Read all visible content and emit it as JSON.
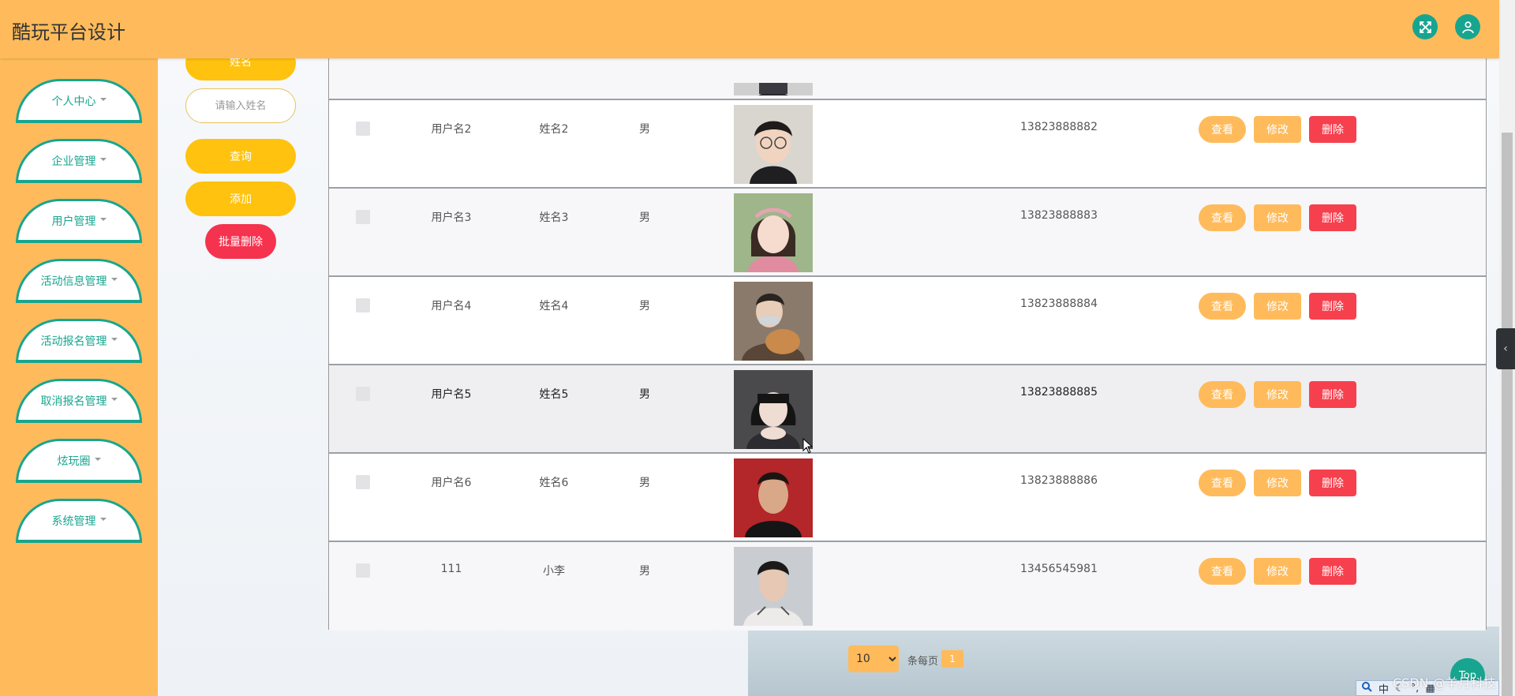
{
  "header": {
    "title": "酷玩平台设计",
    "fullscreen_icon": "fullscreen-icon",
    "user_icon": "user-icon"
  },
  "sidebar": {
    "items": [
      {
        "label": "个人中心"
      },
      {
        "label": "企业管理"
      },
      {
        "label": "用户管理"
      },
      {
        "label": "活动信息管理"
      },
      {
        "label": "活动报名管理"
      },
      {
        "label": "取消报名管理"
      },
      {
        "label": "炫玩圈"
      },
      {
        "label": "系统管理"
      }
    ]
  },
  "search": {
    "name_label": "姓名",
    "name_placeholder": "请输入姓名",
    "query_label": "查询",
    "add_label": "添加",
    "batch_delete_label": "批量删除"
  },
  "table": {
    "rows": [
      {
        "username": "用户名2",
        "name": "姓名2",
        "gender": "男",
        "phone": "13823888882",
        "photo": "portrait-glasses"
      },
      {
        "username": "用户名3",
        "name": "姓名3",
        "gender": "男",
        "phone": "13823888883",
        "photo": "portrait-headband"
      },
      {
        "username": "用户名4",
        "name": "姓名4",
        "gender": "男",
        "phone": "13823888884",
        "photo": "portrait-dog"
      },
      {
        "username": "用户名5",
        "name": "姓名5",
        "gender": "男",
        "phone": "13823888885",
        "photo": "portrait-bangs"
      },
      {
        "username": "用户名6",
        "name": "姓名6",
        "gender": "男",
        "phone": "13823888886",
        "photo": "portrait-red"
      },
      {
        "username": "111",
        "name": "小李",
        "gender": "男",
        "phone": "13456545981",
        "photo": "portrait-jacket"
      }
    ],
    "actions": {
      "view": "查看",
      "edit": "修改",
      "delete": "删除"
    }
  },
  "pagination": {
    "page_size": "10",
    "page_size_options": [
      "10"
    ],
    "per_page_label": "条每页",
    "current_page": "1"
  },
  "back_to_top": "Top",
  "watermark": "CSDN @羊月科技",
  "taskbar": {
    "ime": "中"
  },
  "colors": {
    "header_bg": "#ffbb5b",
    "accent_teal": "#18a58f",
    "button_yellow": "#ffc20e",
    "delete_red": "#f6404e"
  }
}
